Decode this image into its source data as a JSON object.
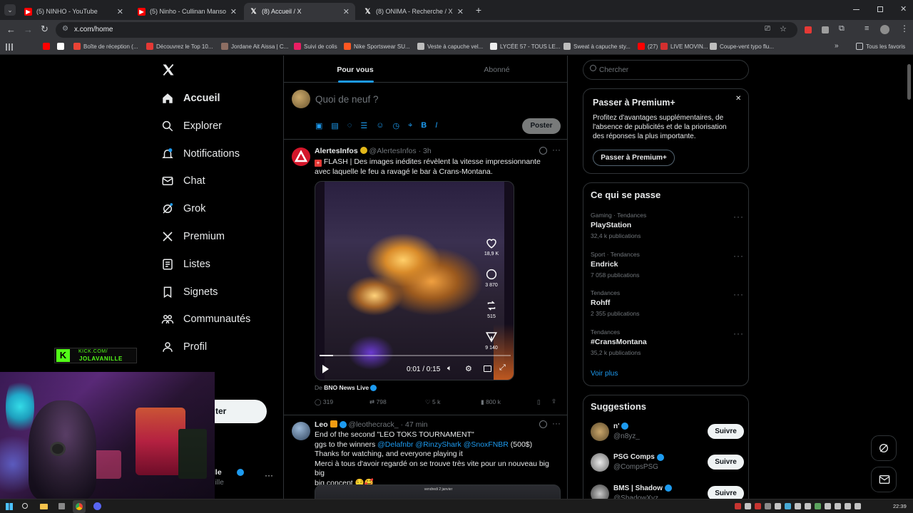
{
  "browser": {
    "tabs": [
      {
        "title": "(5) NINHO - YouTube",
        "icon": "youtube-icon",
        "color": "#ff0000",
        "active": false
      },
      {
        "title": "(5) Ninho - Cullinan Mansory | Cl",
        "icon": "youtube-icon",
        "color": "#ff0000",
        "active": false
      },
      {
        "title": "(8) Accueil / X",
        "icon": "x-logo-icon",
        "color": "#ffffff",
        "active": true
      },
      {
        "title": "(8) ONIMA - Recherche / X",
        "icon": "x-logo-icon",
        "color": "#ffffff",
        "active": false
      }
    ],
    "url": "x.com/home",
    "bookmarks": [
      {
        "label": "",
        "color": "#ff0000"
      },
      {
        "label": "",
        "color": "#ffffff"
      },
      {
        "label": "Boîte de réception (...",
        "color": "#ea4335"
      },
      {
        "label": "Découvrez le Top 10...",
        "color": "#e53935"
      },
      {
        "label": "Jordane Ait Aissa | C...",
        "color": "#8d6e63"
      },
      {
        "label": "Suivi de colis",
        "color": "#e91e63"
      },
      {
        "label": "Nike Sportswear SU...",
        "color": "#ff5722"
      },
      {
        "label": "Veste à capuche vel...",
        "color": "#bdbdbd"
      },
      {
        "label": "LYCÉE 57 - TOUS LE...",
        "color": "#eeeeee"
      },
      {
        "label": "Sweat à capuche sty...",
        "color": "#bdbdbd"
      },
      {
        "label": "(27)",
        "color": "#ff0000"
      },
      {
        "label": "LIVE MOVIN...",
        "color": "#d32f2f"
      },
      {
        "label": "Coupe-vent typo flu...",
        "color": "#bdbdbd"
      }
    ],
    "all_bookmarks": "Tous les favoris"
  },
  "sidebar": {
    "items": [
      {
        "label": "Accueil",
        "icon": "home-icon",
        "active": true
      },
      {
        "label": "Explorer",
        "icon": "search-icon"
      },
      {
        "label": "Notifications",
        "icon": "bell-icon"
      },
      {
        "label": "Chat",
        "icon": "mail-icon"
      },
      {
        "label": "Grok",
        "icon": "grok-icon"
      },
      {
        "label": "Premium",
        "icon": "x-logo-icon"
      },
      {
        "label": "Listes",
        "icon": "list-icon"
      },
      {
        "label": "Signets",
        "icon": "bookmark-icon"
      },
      {
        "label": "Communautés",
        "icon": "communities-icon"
      },
      {
        "label": "Profil",
        "icon": "profile-icon"
      }
    ],
    "post_button_partial": "ter",
    "account_name_partial": "lle",
    "account_handle_partial": "nille",
    "more": "···"
  },
  "overlay": {
    "kick_url": "KICK.COM/",
    "kick_channel": "JOLAVANILLE"
  },
  "feed": {
    "tabs": [
      "Pour vous",
      "Abonné"
    ],
    "compose_placeholder": "Quoi de neuf ?",
    "post_button": "Poster",
    "posts": [
      {
        "name": "AlertesInfos",
        "handle": "@AlertesInfos",
        "time": "3h",
        "text": "FLASH | Des images inédites révèlent la vitesse impressionnante avec laquelle le feu a ravagé le bar à Crans-Montana.",
        "video": {
          "time": "0:01 / 0:15",
          "likes": "18,9 K",
          "replies": "3 870",
          "reposts": "515",
          "shares": "9 140",
          "progress": 0.07
        },
        "from_prefix": "De",
        "from": "BNO News Live",
        "stats": {
          "replies": "319",
          "reposts": "798",
          "likes": "5 k",
          "views": "800 k"
        }
      },
      {
        "name": "Leo",
        "handle": "@leothecrack_",
        "time": "47 min",
        "line1": "End of the second \"LEO TOKS TOURNAMENT\"",
        "line2_prefix": "ggs to the winners",
        "mentions": [
          "@Delafnbr",
          "@RinzyShark",
          "@SnoxFNBR"
        ],
        "line2_suffix": "(500$)",
        "line3": "Thanks for watching, and everyone playing it",
        "line4": "Merci à tous d'avoir regardé on se trouve très vite pour un nouveau big big",
        "line5": "big concept 😌🥰",
        "image_caption": "vendredi 2 janvier"
      }
    ]
  },
  "right": {
    "search_placeholder": "Chercher",
    "premium": {
      "title": "Passer à Premium+",
      "text1": "Profitez d'avantages supplémentaires, de",
      "text2": "l'absence de publicités et de la priorisation",
      "text3": "des réponses la plus importante.",
      "button": "Passer à Premium+"
    },
    "trends_title": "Ce qui se passe",
    "trends": [
      {
        "meta": "Gaming · Tendances",
        "name": "PlayStation",
        "count": "32,4 k publications"
      },
      {
        "meta": "Sport · Tendances",
        "name": "Endrick",
        "count": "7 058 publications"
      },
      {
        "meta": "Tendances",
        "name": "Rohff",
        "count": "2 355 publications"
      },
      {
        "meta": "Tendances",
        "name": "#CransMontana",
        "count": "35,2 k publications"
      }
    ],
    "show_more": "Voir plus",
    "suggestions_title": "Suggestions",
    "suggestions": [
      {
        "name": "n'",
        "handle": "@n8yz_",
        "button": "Suivre"
      },
      {
        "name": "PSG Comps",
        "handle": "@CompsPSG",
        "button": "Suivre"
      },
      {
        "name": "BMS | Shadow",
        "handle": "@ShadowXyz",
        "button": "Suivre"
      }
    ]
  },
  "taskbar": {
    "clock": "22:39"
  },
  "colors": {
    "accent": "#1d9bf0",
    "text": "#e7e9ea",
    "muted": "#71767b",
    "border": "#2f3336",
    "kick": "#53fc18"
  }
}
